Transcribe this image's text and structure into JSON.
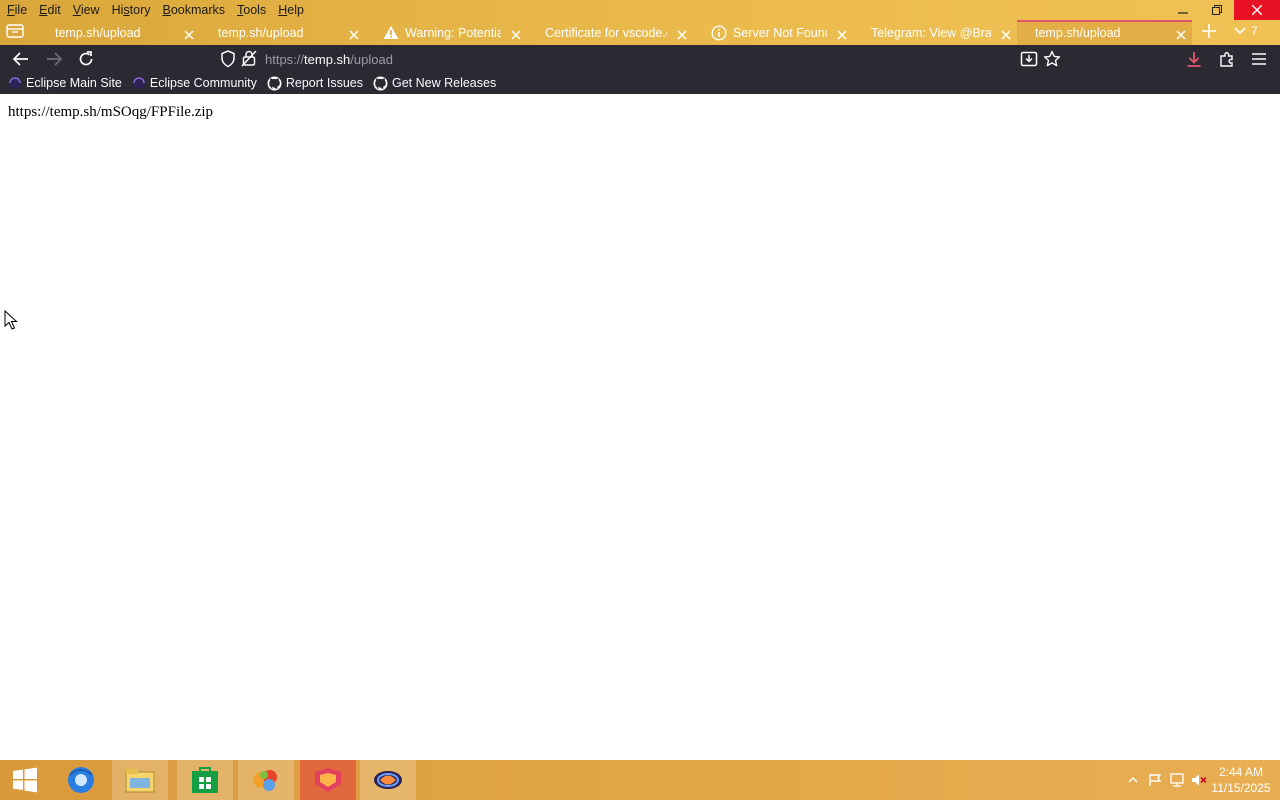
{
  "window": {
    "menu": [
      {
        "pre": "",
        "acc": "F",
        "post": "ile"
      },
      {
        "pre": "",
        "acc": "E",
        "post": "dit"
      },
      {
        "pre": "",
        "acc": "V",
        "post": "iew"
      },
      {
        "pre": "Hi",
        "acc": "s",
        "post": "tory"
      },
      {
        "pre": "",
        "acc": "B",
        "post": "ookmarks"
      },
      {
        "pre": "",
        "acc": "T",
        "post": "ools"
      },
      {
        "pre": "",
        "acc": "H",
        "post": "elp"
      }
    ]
  },
  "tabs": [
    {
      "title": "temp.sh/upload",
      "icon": "none",
      "active": false
    },
    {
      "title": "temp.sh/upload",
      "icon": "none",
      "active": false
    },
    {
      "title": "Warning: Potential S",
      "icon": "warning-icon",
      "active": false
    },
    {
      "title": "Certificate for vscode.dc",
      "icon": "none",
      "active": false
    },
    {
      "title": "Server Not Found",
      "icon": "info-icon",
      "active": false
    },
    {
      "title": "Telegram: View @Brazil_",
      "icon": "none",
      "active": false
    },
    {
      "title": "temp.sh/upload",
      "icon": "none",
      "active": true
    }
  ],
  "tab_overflow_count": "7",
  "navbar": {
    "url_scheme": "https://",
    "url_host": "temp.sh",
    "url_path": "/upload"
  },
  "bookmarks": [
    {
      "label": "Eclipse Main Site",
      "icon": "eclipse-icon"
    },
    {
      "label": "Eclipse Community",
      "icon": "eclipse-icon"
    },
    {
      "label": "Report Issues",
      "icon": "github-icon"
    },
    {
      "label": "Get New Releases",
      "icon": "github-icon"
    }
  ],
  "content": {
    "text": "https://temp.sh/mSOqg/FPFile.zip"
  },
  "taskbar": {
    "apps": [
      {
        "name": "chrome-like-browser-icon"
      },
      {
        "name": "file-explorer-icon"
      },
      {
        "name": "store-icon"
      },
      {
        "name": "colorful-app-icon"
      },
      {
        "name": "firefox-style-app-icon"
      },
      {
        "name": "eclipse-ide-icon"
      }
    ],
    "clock_time": "2:44 AM",
    "clock_date": "11/15/2025"
  },
  "colors": {
    "titlebar": "#e2ae45",
    "toolbar": "#2b2a33",
    "active_tab_accent": "#e2556e",
    "download_accent": "#e2556e"
  }
}
